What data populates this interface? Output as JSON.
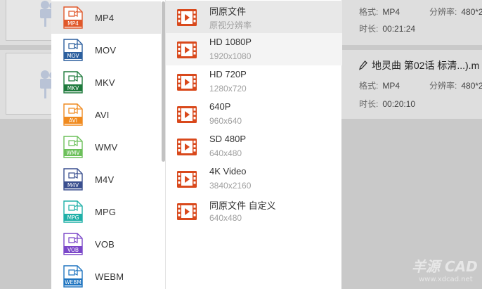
{
  "files": [
    {
      "format_label": "格式:",
      "format_value": "MP4",
      "resolution_label": "分辨率:",
      "resolution_value": "480*2",
      "duration_label": "时长:",
      "duration_value": "00:21:24"
    },
    {
      "title": "地灵曲 第02话 标清...).m",
      "format_label": "格式:",
      "format_value": "MP4",
      "resolution_label": "分辨率:",
      "resolution_value": "480*2",
      "duration_label": "时长:",
      "duration_value": "00:20:10"
    }
  ],
  "formats": [
    {
      "label": "MP4",
      "tag": "MP4",
      "color": "#e0582a",
      "selected": true
    },
    {
      "label": "MOV",
      "tag": "MOV",
      "color": "#2c5f9e"
    },
    {
      "label": "MKV",
      "tag": "MKV",
      "color": "#1e7a3c"
    },
    {
      "label": "AVI",
      "tag": "AVI",
      "color": "#f08a1e"
    },
    {
      "label": "WMV",
      "tag": "WMV",
      "color": "#6cc05a"
    },
    {
      "label": "M4V",
      "tag": "M4V",
      "color": "#3a4f8f"
    },
    {
      "label": "MPG",
      "tag": "MPG",
      "color": "#20b0a8"
    },
    {
      "label": "VOB",
      "tag": "VOB",
      "color": "#7b47c9"
    },
    {
      "label": "WEBM",
      "tag": "WEBM",
      "color": "#1e74c0"
    }
  ],
  "presets": [
    {
      "name": "同原文件",
      "res": "原视分辨率",
      "state": "selected"
    },
    {
      "name": "HD 1080P",
      "res": "1920x1080",
      "state": "hover"
    },
    {
      "name": "HD 720P",
      "res": "1280x720"
    },
    {
      "name": "640P",
      "res": "960x640"
    },
    {
      "name": "SD 480P",
      "res": "640x480"
    },
    {
      "name": "4K Video",
      "res": "3840x2160"
    },
    {
      "name": "同原文件 自定义",
      "res": "640x480"
    }
  ],
  "colors": {
    "film_icon": "#d9491c"
  },
  "icons": {
    "camera": "video-camera-icon",
    "edit": "pencil-icon",
    "film": "film-play-icon"
  }
}
